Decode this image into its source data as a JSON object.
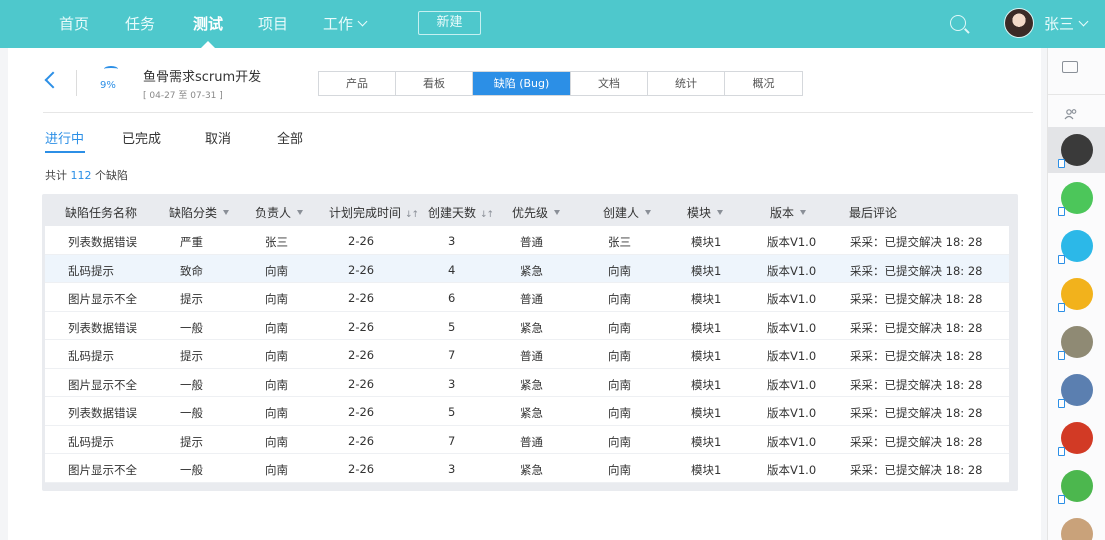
{
  "nav": {
    "items": [
      "首页",
      "任务",
      "测试",
      "项目",
      "工作"
    ],
    "active_index": 2,
    "new_button": "新建",
    "user_name": "张三"
  },
  "project": {
    "back_icon": "chevron-left-icon",
    "progress": "9%",
    "progress_value": 0.09,
    "title": "鱼骨需求scrum开发",
    "date_range": "[ 04-27 至 07-31 ]"
  },
  "tabs": [
    "产品",
    "看板",
    "缺陷 (Bug)",
    "文档",
    "统计",
    "概况"
  ],
  "active_tab_index": 2,
  "status_tabs": [
    "进行中",
    "已完成",
    "取消",
    "全部"
  ],
  "active_status_index": 0,
  "count": {
    "prefix": "共计",
    "value": "112",
    "suffix": "个缺陷"
  },
  "table": {
    "columns": [
      "缺陷任务名称",
      "缺陷分类",
      "负责人",
      "计划完成时间",
      "创建天数",
      "优先级",
      "创建人",
      "模块",
      "版本",
      "最后评论"
    ],
    "rows": [
      [
        "列表数据错误",
        "严重",
        "张三",
        "2-26",
        "3",
        "普通",
        "张三",
        "模块1",
        "版本V1.0",
        "采采：已提交解决  18: 28"
      ],
      [
        "乱码提示",
        "致命",
        "向南",
        "2-26",
        "4",
        "紧急",
        "向南",
        "模块1",
        "版本V1.0",
        "采采：已提交解决  18: 28"
      ],
      [
        "图片显示不全",
        "提示",
        "向南",
        "2-26",
        "6",
        "普通",
        "向南",
        "模块1",
        "版本V1.0",
        "采采：已提交解决  18: 28"
      ],
      [
        "列表数据错误",
        "一般",
        "向南",
        "2-26",
        "5",
        "紧急",
        "向南",
        "模块1",
        "版本V1.0",
        "采采：已提交解决  18: 28"
      ],
      [
        "乱码提示",
        "提示",
        "向南",
        "2-26",
        "7",
        "普通",
        "向南",
        "模块1",
        "版本V1.0",
        "采采：已提交解决  18: 28"
      ],
      [
        "图片显示不全",
        "一般",
        "向南",
        "2-26",
        "3",
        "紧急",
        "向南",
        "模块1",
        "版本V1.0",
        "采采：已提交解决  18: 28"
      ],
      [
        "列表数据错误",
        "一般",
        "向南",
        "2-26",
        "5",
        "紧急",
        "向南",
        "模块1",
        "版本V1.0",
        "采采：已提交解决  18: 28"
      ],
      [
        "乱码提示",
        "提示",
        "向南",
        "2-26",
        "7",
        "普通",
        "向南",
        "模块1",
        "版本V1.0",
        "采采：已提交解决  18: 28"
      ],
      [
        "图片显示不全",
        "一般",
        "向南",
        "2-26",
        "3",
        "紧急",
        "向南",
        "模块1",
        "版本V1.0",
        "采采：已提交解决  18: 28"
      ]
    ],
    "highlighted_row": 1
  },
  "sidebar": {
    "icons": [
      "chat-icon",
      "group-icon"
    ],
    "contacts": [
      {
        "icon": "avatar-girl",
        "color": "#3a3a3a"
      },
      {
        "icon": "avatar-fish",
        "color": "#4cc65a"
      },
      {
        "icon": "avatar-person",
        "color": "#2cb8e8"
      },
      {
        "icon": "avatar-speaker",
        "color": "#f2b21c"
      },
      {
        "icon": "avatar-turtle",
        "color": "#8f8a74"
      },
      {
        "icon": "avatar-globe",
        "color": "#5b7fb0"
      },
      {
        "icon": "avatar-festive",
        "color": "#d23a25"
      },
      {
        "icon": "avatar-stickman",
        "color": "#4cb74e"
      },
      {
        "icon": "avatar-cat",
        "color": "#c9a27a"
      }
    ]
  },
  "colors": {
    "nav_bg": "#4ec8cc",
    "accent": "#2c8fe6"
  }
}
